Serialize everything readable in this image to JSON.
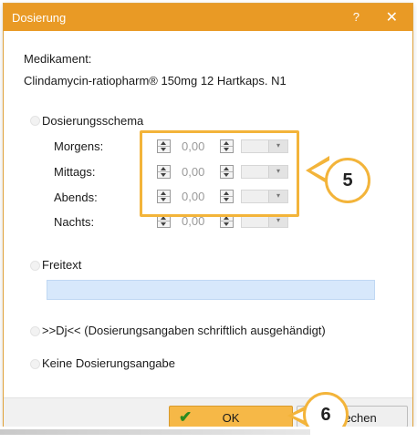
{
  "window": {
    "title": "Dosierung",
    "help_label": "?",
    "close_label": "✕"
  },
  "medication": {
    "label": "Medikament:",
    "name": "Clindamycin-ratiopharm® 150mg 12 Hartkaps. N1"
  },
  "options": {
    "schema_label": "Dosierungsschema",
    "freitext_label": "Freitext",
    "freitext_value": "",
    "dj_label": ">>Dj<< (Dosierungsangaben schriftlich ausgehändigt)",
    "none_label": "Keine Dosierungsangabe"
  },
  "schema_rows": [
    {
      "label": "Morgens:",
      "value": "0,00",
      "unit": ""
    },
    {
      "label": "Mittags:",
      "value": "0,00",
      "unit": ""
    },
    {
      "label": "Abends:",
      "value": "0,00",
      "unit": ""
    },
    {
      "label": "Nachts:",
      "value": "0,00",
      "unit": ""
    }
  ],
  "buttons": {
    "ok_label": "OK",
    "cancel_label_visible": "rechen"
  },
  "callouts": {
    "schema_number": "5",
    "ok_number": "6"
  },
  "colors": {
    "titlebar": "#e99a25",
    "accent": "#f3b43a",
    "ok_button": "#f6b847",
    "freitext_field": "#d7e8fb"
  },
  "icons": {
    "ok": "checkmark-icon",
    "spin_up": "spin-up-icon",
    "spin_down": "spin-down-icon",
    "dropdown": "dropdown-arrow-icon"
  }
}
